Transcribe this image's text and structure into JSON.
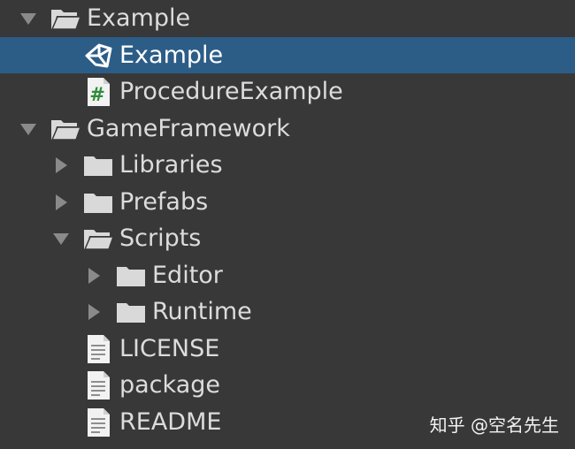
{
  "tree": [
    {
      "label": "Example",
      "icon": "folder-open-icon",
      "arrow": "expanded",
      "depth": 0
    },
    {
      "label": "Example",
      "icon": "unity-scene-icon",
      "arrow": "none",
      "depth": 1,
      "selected": true
    },
    {
      "label": "ProcedureExample",
      "icon": "csharp-script-icon",
      "arrow": "none",
      "depth": 1
    },
    {
      "label": "GameFramework",
      "icon": "folder-open-icon",
      "arrow": "expanded",
      "depth": 0
    },
    {
      "label": "Libraries",
      "icon": "folder-icon",
      "arrow": "collapsed",
      "depth": 1
    },
    {
      "label": "Prefabs",
      "icon": "folder-icon",
      "arrow": "collapsed",
      "depth": 1
    },
    {
      "label": "Scripts",
      "icon": "folder-open-icon",
      "arrow": "expanded",
      "depth": 1
    },
    {
      "label": "Editor",
      "icon": "folder-icon",
      "arrow": "collapsed",
      "depth": 2
    },
    {
      "label": "Runtime",
      "icon": "folder-icon",
      "arrow": "collapsed",
      "depth": 2
    },
    {
      "label": "LICENSE",
      "icon": "text-file-icon",
      "arrow": "none",
      "depth": 1
    },
    {
      "label": "package",
      "icon": "text-file-icon",
      "arrow": "none",
      "depth": 1
    },
    {
      "label": "README",
      "icon": "text-file-icon",
      "arrow": "none",
      "depth": 1
    }
  ],
  "colors": {
    "background": "#383838",
    "selection": "#2c5d87",
    "text": "#dcdcdc",
    "icon": "#d9d9d9",
    "arrow": "#8a8a8a"
  },
  "watermark": "知乎 @空名先生"
}
